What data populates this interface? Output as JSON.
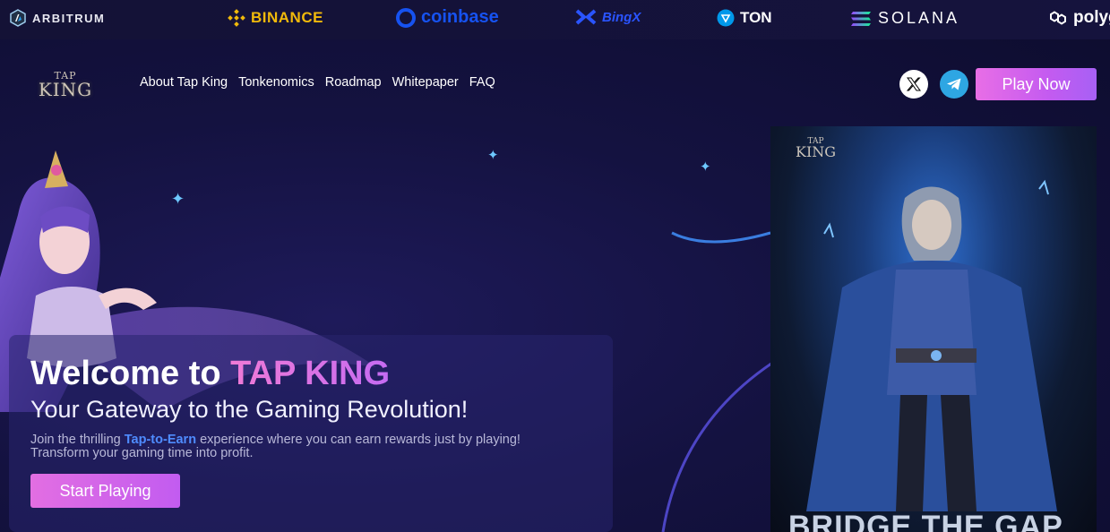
{
  "partners": {
    "arbitrum": "ARBITRUM",
    "binance": "BINANCE",
    "coinbase": "coinbase",
    "bingx": "BingX",
    "ton": "TON",
    "solana": "SOLANA",
    "polygon": "polyg"
  },
  "logo": {
    "tap": "TAP",
    "king": "KING"
  },
  "nav": {
    "items": [
      "About Tap King",
      "Tonkenomics",
      "Roadmap",
      "Whitepaper",
      "FAQ"
    ]
  },
  "social": {
    "x_icon": "x-logo-icon",
    "telegram_icon": "telegram-icon"
  },
  "header": {
    "play_now": "Play Now"
  },
  "hero": {
    "title_prefix": "Welcome to ",
    "title_accent": "TAP KING",
    "subtitle": "Your Gateway to the Gaming Revolution!",
    "desc_before": "Join the thrilling ",
    "desc_highlight": "Tap-to-Earn",
    "desc_after": " experience where you can earn rewards just by playing! Transform your gaming time into profit.",
    "cta": "Start Playing"
  },
  "poster": {
    "logo_tap": "TAP",
    "logo_king": "KING",
    "banner": "BRIDGE THE GAP"
  },
  "colors": {
    "accent_pink": "#e86ee6",
    "accent_purple": "#a760f5",
    "highlight_blue": "#4f8cff",
    "binance_yellow": "#f0b90b",
    "coinbase_blue": "#1652f0"
  }
}
